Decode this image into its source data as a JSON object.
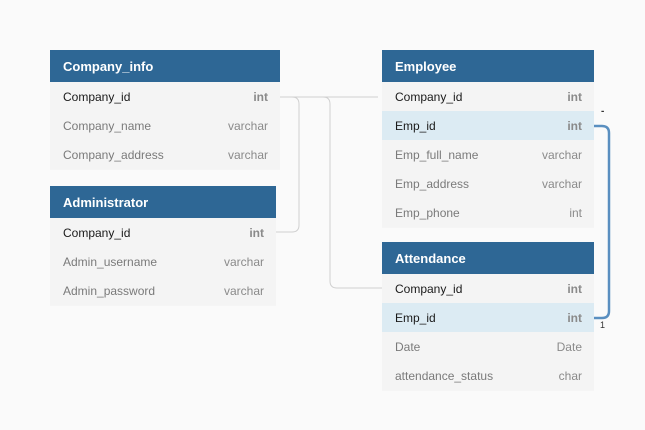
{
  "tables": {
    "company_info": {
      "title": "Company_info",
      "columns": [
        {
          "name": "Company_id",
          "type": "int"
        },
        {
          "name": "Company_name",
          "type": "varchar"
        },
        {
          "name": "Company_address",
          "type": "varchar"
        }
      ]
    },
    "administrator": {
      "title": "Administrator",
      "columns": [
        {
          "name": "Company_id",
          "type": "int"
        },
        {
          "name": "Admin_username",
          "type": "varchar"
        },
        {
          "name": "Admin_password",
          "type": "varchar"
        }
      ]
    },
    "employee": {
      "title": "Employee",
      "columns": [
        {
          "name": "Company_id",
          "type": "int"
        },
        {
          "name": "Emp_id",
          "type": "int"
        },
        {
          "name": "Emp_full_name",
          "type": "varchar"
        },
        {
          "name": "Emp_address",
          "type": "varchar"
        },
        {
          "name": "Emp_phone",
          "type": "int"
        }
      ]
    },
    "attendance": {
      "title": "Attendance",
      "columns": [
        {
          "name": "Company_id",
          "type": "int"
        },
        {
          "name": "Emp_id",
          "type": "int"
        },
        {
          "name": "Date",
          "type": "Date"
        },
        {
          "name": "attendance_status",
          "type": "char"
        }
      ]
    }
  },
  "relationship_labels": {
    "emp_id_one": "1",
    "emp_id_many": "-"
  },
  "colors": {
    "header": "#2e6795",
    "highlight_row": "#dcebf3",
    "connector": "#c8c8c8",
    "relationship_line": "#5a8fc0"
  }
}
